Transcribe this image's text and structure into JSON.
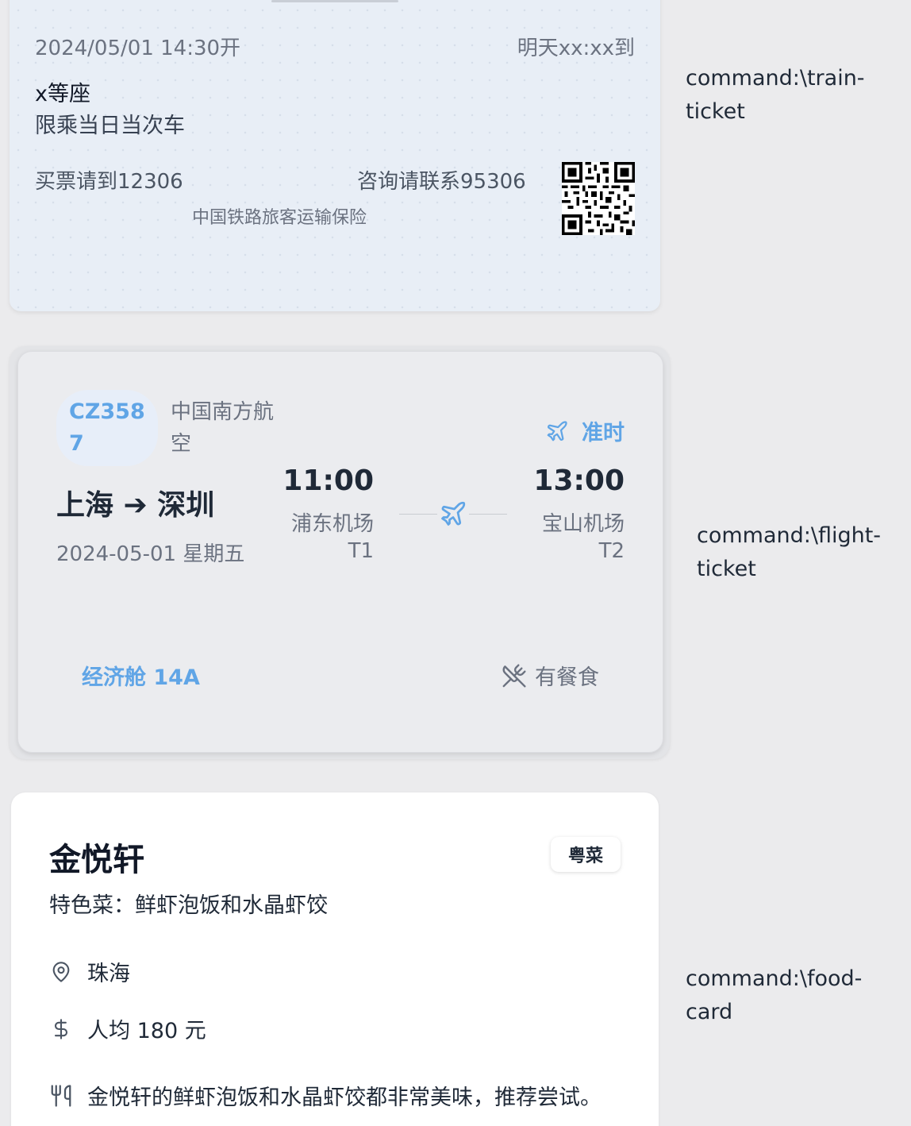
{
  "train_ticket": {
    "depart": "2024/05/01 14:30开",
    "arrive": "明天xx:xx到",
    "seat": "x等座",
    "limit": "限乘当日当次车",
    "buy": "买票请到12306",
    "contact": "咨询请联系95306",
    "insurance": "中国铁路旅客运输保险",
    "qr_icon": "qr-code-icon"
  },
  "flight_ticket": {
    "flight_no": "CZ3587",
    "airline": "中国南方航空",
    "status": "准时",
    "route": "上海 ➔ 深圳",
    "date": "2024-05-01 星期五",
    "departure": {
      "time": "11:00",
      "airport": "浦东机场",
      "terminal": "T1"
    },
    "arrival": {
      "time": "13:00",
      "airport": "宝山机场",
      "terminal": "T2"
    },
    "cabin_seat": "经济舱 14A",
    "meal": "有餐食",
    "accent_color": "#60a5e6"
  },
  "food_card": {
    "name": "金悦轩",
    "cuisine": "粤菜",
    "specialty": "特色菜：鲜虾泡饭和水晶虾饺",
    "location": "珠海",
    "price": "人均 180 元",
    "review": "金悦轩的鲜虾泡饭和水晶虾饺都非常美味，推荐尝试。"
  },
  "commands": {
    "train": "command:\\train-ticket",
    "flight": "command:\\flight-ticket",
    "food": "command:\\food-card"
  }
}
